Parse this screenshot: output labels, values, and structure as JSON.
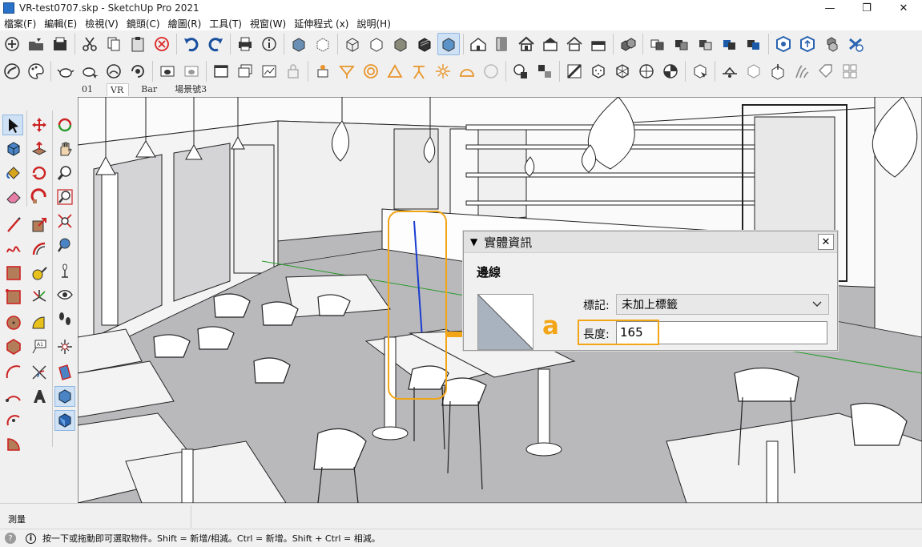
{
  "window": {
    "title": "VR-test0707.skp - SketchUp Pro 2021",
    "minimize": "—",
    "restore": "❐",
    "close": "✕"
  },
  "menu": [
    "檔案(F)",
    "編輯(E)",
    "檢視(V)",
    "鏡頭(C)",
    "繪圖(R)",
    "工具(T)",
    "視窗(W)",
    "延伸程式 (x)",
    "說明(H)"
  ],
  "scene_tabs": [
    "01",
    "VR",
    "Bar",
    "場景號3"
  ],
  "active_scene_tab": "VR",
  "entity_info": {
    "title": "實體資訊",
    "collapse_glyph": "▼",
    "close_glyph": "✕",
    "entity_type": "邊線",
    "tag_label": "標記:",
    "tag_value": "未加上標籤",
    "length_label": "長度:",
    "length_value": "165"
  },
  "callout": {
    "letter": "a",
    "color": "#f2a516"
  },
  "measurements_label": "測量",
  "status": {
    "hint": "按一下或拖動即可選取物件。Shift = 新增/相減。Ctrl = 新增。Shift + Ctrl = 相減。",
    "info_glyph": "i",
    "geo_glyph": "?"
  },
  "colors": {
    "accent": "#f2a516",
    "selected_tool_bg": "#cfe1f5",
    "viewport_floor": "#b9b9bc"
  }
}
